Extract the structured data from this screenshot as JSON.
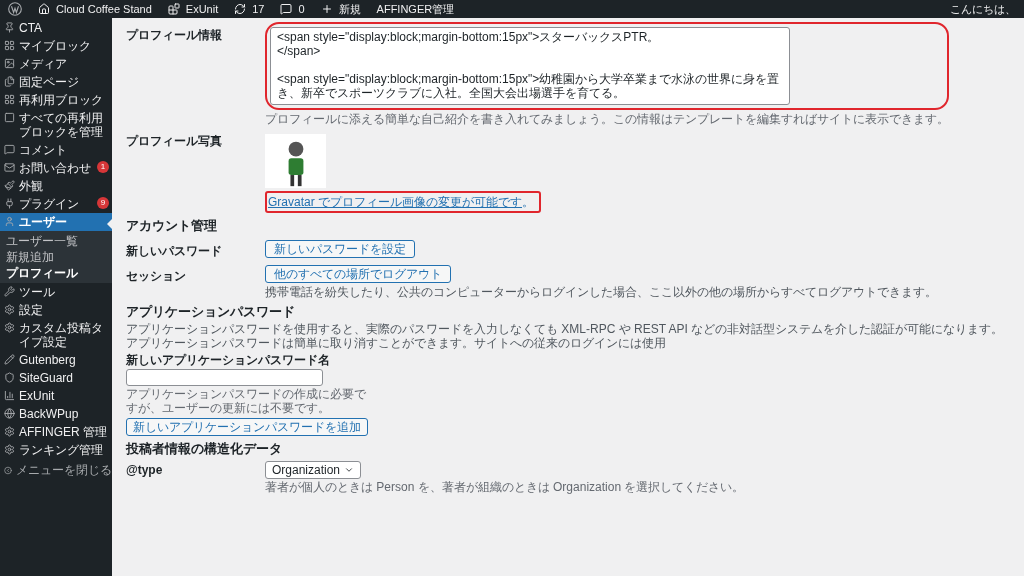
{
  "admin_bar": {
    "items": [
      {
        "kind": "logo"
      },
      {
        "kind": "home",
        "label": "Cloud Coffee Stand"
      },
      {
        "kind": "plugin",
        "label": "ExUnit"
      },
      {
        "kind": "updates",
        "label": "17"
      },
      {
        "kind": "comments",
        "label": "0"
      },
      {
        "kind": "new",
        "label": "新規"
      },
      {
        "kind": "text",
        "label": "AFFINGER管理"
      }
    ],
    "greeting": "こんにちは、"
  },
  "sidebar": {
    "items": [
      {
        "label": "CTA",
        "selected": false
      },
      {
        "label": "マイブロック",
        "selected": false
      },
      {
        "label": "メディア",
        "selected": false
      },
      {
        "label": "固定ページ",
        "selected": false
      },
      {
        "label": "再利用ブロック",
        "selected": false
      },
      {
        "label": "すべての再利用ブロックを管理",
        "selected": false
      },
      {
        "label": "コメント",
        "selected": false
      },
      {
        "label": "お問い合わせ",
        "selected": false,
        "badge": "1"
      },
      {
        "label": "外観",
        "selected": false
      },
      {
        "label": "プラグイン",
        "selected": false,
        "badge": "9"
      },
      {
        "label": "ユーザー",
        "selected": true,
        "children": [
          {
            "label": "ユーザー一覧",
            "selected": false
          },
          {
            "label": "新規追加",
            "selected": false
          },
          {
            "label": "プロフィール",
            "selected": true
          }
        ]
      },
      {
        "label": "ツール",
        "selected": false
      },
      {
        "label": "設定",
        "selected": false
      },
      {
        "label": "カスタム投稿タイプ設定",
        "selected": false
      },
      {
        "label": "Gutenberg",
        "selected": false
      },
      {
        "label": "SiteGuard",
        "selected": false
      },
      {
        "label": "ExUnit",
        "selected": false
      },
      {
        "label": "BackWPup",
        "selected": false
      },
      {
        "label": "AFFINGER 管理",
        "selected": false
      },
      {
        "label": "ランキング管理",
        "selected": false
      }
    ],
    "collapse": "メニューを閉じる"
  },
  "profile": {
    "bio": {
      "label": "プロフィール情報",
      "value": "<span style=\"display:block;margin-bottom:15px\">スターバックスPTR。\n</span>\n\n<span style=\"display:block;margin-bottom:15px\">幼稚園から大学卒業まで水泳の世界に身を置き、新卒でスポーツクラブに入社。全国大会出場選手を育てる。",
      "description": "プロフィールに添える簡単な自己紹介を書き入れてみましょう。この情報はテンプレートを編集すればサイトに表示できます。",
      "highlighted": true
    },
    "photo": {
      "label": "プロフィール写真",
      "link": "Gravatar でプロフィール画像の変更が可能です",
      "suffix": "。",
      "highlighted": true
    }
  },
  "account": {
    "heading": "アカウント管理",
    "rows": [
      {
        "label": "新しいパスワード",
        "button": "新しいパスワードを設定"
      },
      {
        "label": "セッション",
        "button": "他のすべての場所でログアウト",
        "description": "携帯電話を紛失したり、公共のコンピューターからログインした場合、ここ以外の他の場所からすべてログアウトできます。"
      }
    ]
  },
  "app_password": {
    "heading": "アプリケーションパスワード",
    "intro": "アプリケーションパスワードを使用すると、実際のパスワードを入力しなくても XML-RPC や REST API などの非対話型システムを介した認証が可能になります。アプリケーションパスワードは簡単に取り消すことができます。サイトへの従来のログインには使用",
    "field_label": "新しいアプリケーションパスワード名",
    "field_hint": "アプリケーションパスワードの作成に必要ですが、ユーザーの更新には不要です。",
    "button": "新しいアプリケーションパスワードを追加"
  },
  "structured": {
    "heading": "投稿者情報の構造化データ",
    "type_label": "@type",
    "type_value": "Organization",
    "type_hint": "著者が個人のときは Person を、著者が組織のときは Organization を選択してください。"
  }
}
